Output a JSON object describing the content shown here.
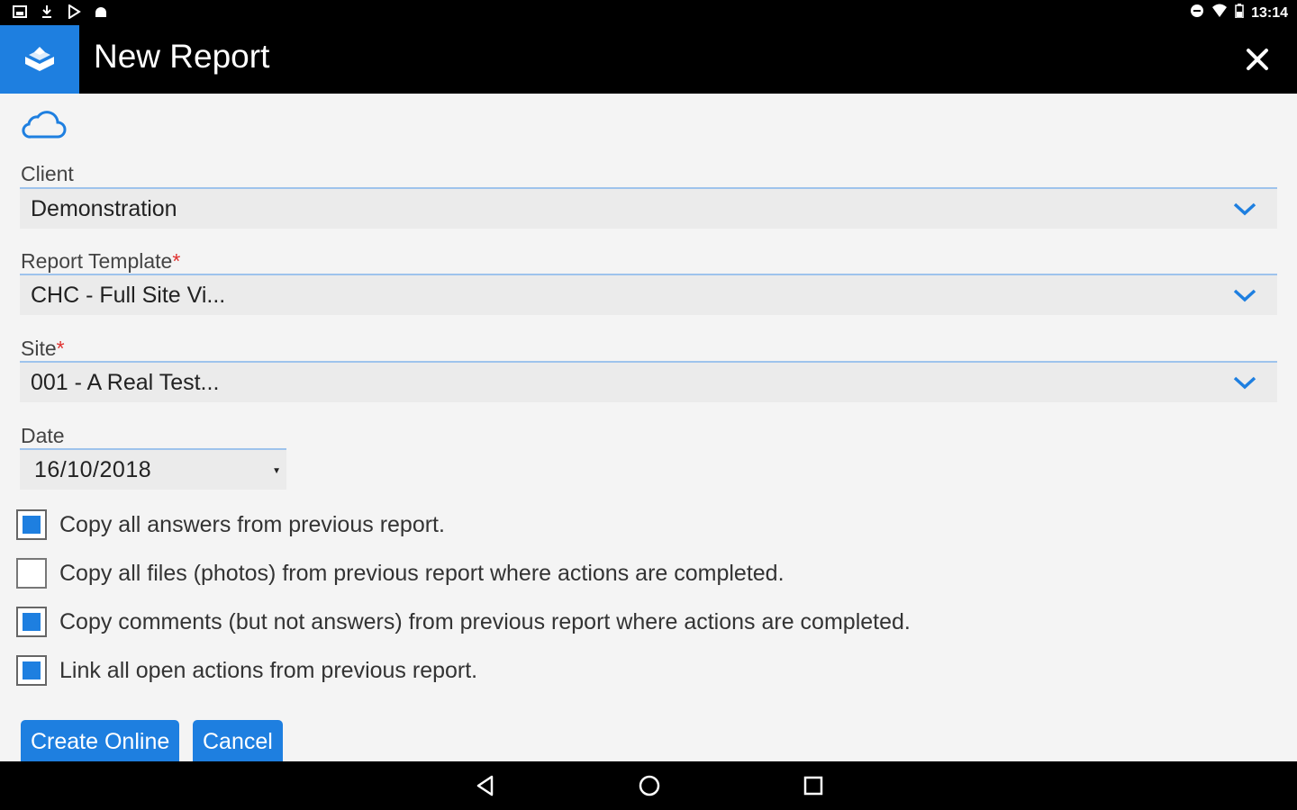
{
  "status_bar": {
    "time": "13:14",
    "left_icons": [
      "gallery-icon",
      "download-icon",
      "play-store-icon",
      "android-icon"
    ],
    "right_icons": [
      "data-saver-icon",
      "wifi-icon",
      "battery-icon"
    ]
  },
  "app_bar": {
    "title": "New Report",
    "logo_icon": "app-logo-icon",
    "close_icon": "close-icon"
  },
  "form": {
    "sync_icon": "cloud-icon",
    "client": {
      "label": "Client",
      "value": "Demonstration"
    },
    "template": {
      "label": "Report Template",
      "required_mark": "*",
      "value": "CHC - Full Site Vi..."
    },
    "site": {
      "label": "Site",
      "required_mark": "*",
      "value": "001 - A Real Test..."
    },
    "date": {
      "label": "Date",
      "value": "16/10/2018"
    }
  },
  "options": [
    {
      "label": "Copy all answers from previous report.",
      "checked": true
    },
    {
      "label": "Copy all files (photos) from previous report where actions are completed.",
      "checked": false
    },
    {
      "label": "Copy comments (but not answers) from previous report where actions are completed.",
      "checked": true
    },
    {
      "label": "Link all open actions from previous report.",
      "checked": true
    }
  ],
  "buttons": {
    "create": "Create Online",
    "cancel": "Cancel"
  },
  "nav_bar": {
    "icons": [
      "back-icon",
      "home-icon",
      "recents-icon"
    ]
  },
  "colors": {
    "accent": "#1e7fe0",
    "required": "#e0312f",
    "background": "#f4f4f4"
  }
}
